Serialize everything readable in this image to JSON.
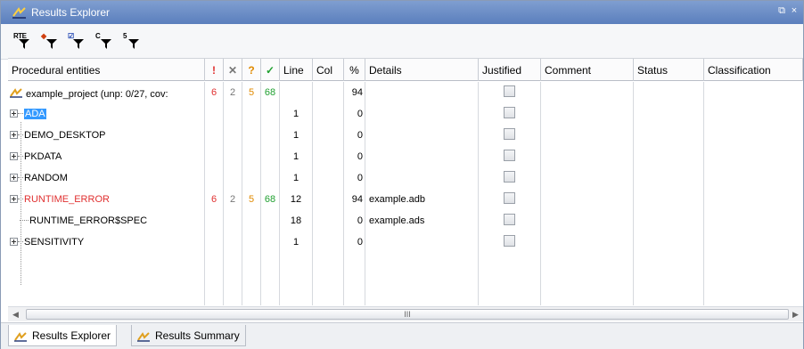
{
  "window": {
    "title": "Results Explorer",
    "restore_glyph": "⧉",
    "close_glyph": "×"
  },
  "toolbar": {
    "filters": [
      {
        "label": "RTE",
        "icon": "rte-filter-icon"
      },
      {
        "label": "◆",
        "icon": "color-filter-icon"
      },
      {
        "label": "☑",
        "icon": "check-filter-icon"
      },
      {
        "label": "C",
        "icon": "c-filter-icon"
      },
      {
        "label": "5",
        "icon": "five-filter-icon"
      }
    ]
  },
  "columns": {
    "procedural_entities": "Procedural entities",
    "red": "!",
    "grey": "✕",
    "orange": "?",
    "green": "✓",
    "line": "Line",
    "col": "Col",
    "pct": "%",
    "details": "Details",
    "justified": "Justified",
    "comment": "Comment",
    "status": "Status",
    "classification": "Classification"
  },
  "rows": [
    {
      "name": "example_project (unp: 0/27, cov:",
      "red": "6",
      "grey": "2",
      "orange": "5",
      "green": "68",
      "line": "",
      "col": "",
      "pct": "94",
      "details": ""
    },
    {
      "name": "ADA",
      "red": "",
      "grey": "",
      "orange": "",
      "green": "",
      "line": "1",
      "col": "",
      "pct": "0",
      "details": ""
    },
    {
      "name": "DEMO_DESKTOP",
      "red": "",
      "grey": "",
      "orange": "",
      "green": "",
      "line": "1",
      "col": "",
      "pct": "0",
      "details": ""
    },
    {
      "name": "PKDATA",
      "red": "",
      "grey": "",
      "orange": "",
      "green": "",
      "line": "1",
      "col": "",
      "pct": "0",
      "details": ""
    },
    {
      "name": "RANDOM",
      "red": "",
      "grey": "",
      "orange": "",
      "green": "",
      "line": "1",
      "col": "",
      "pct": "0",
      "details": ""
    },
    {
      "name": "RUNTIME_ERROR",
      "red": "6",
      "grey": "2",
      "orange": "5",
      "green": "68",
      "line": "12",
      "col": "",
      "pct": "94",
      "details": "example.adb"
    },
    {
      "name": "RUNTIME_ERROR$SPEC",
      "red": "",
      "grey": "",
      "orange": "",
      "green": "",
      "line": "18",
      "col": "",
      "pct": "0",
      "details": "example.ads"
    },
    {
      "name": "SENSITIVITY",
      "red": "",
      "grey": "",
      "orange": "",
      "green": "",
      "line": "1",
      "col": "",
      "pct": "0",
      "details": ""
    }
  ],
  "scrollbar": {
    "thumb_glyph": "III",
    "left_arrow": "◀",
    "right_arrow": "▶"
  },
  "tabs": [
    {
      "label": "Results Explorer"
    },
    {
      "label": "Results Summary"
    }
  ],
  "colors": {
    "red": "#e03030",
    "grey": "#777777",
    "orange": "#e08a00",
    "green": "#20a030",
    "selection": "#3399ff",
    "titlebar": "#6b8cc6"
  }
}
